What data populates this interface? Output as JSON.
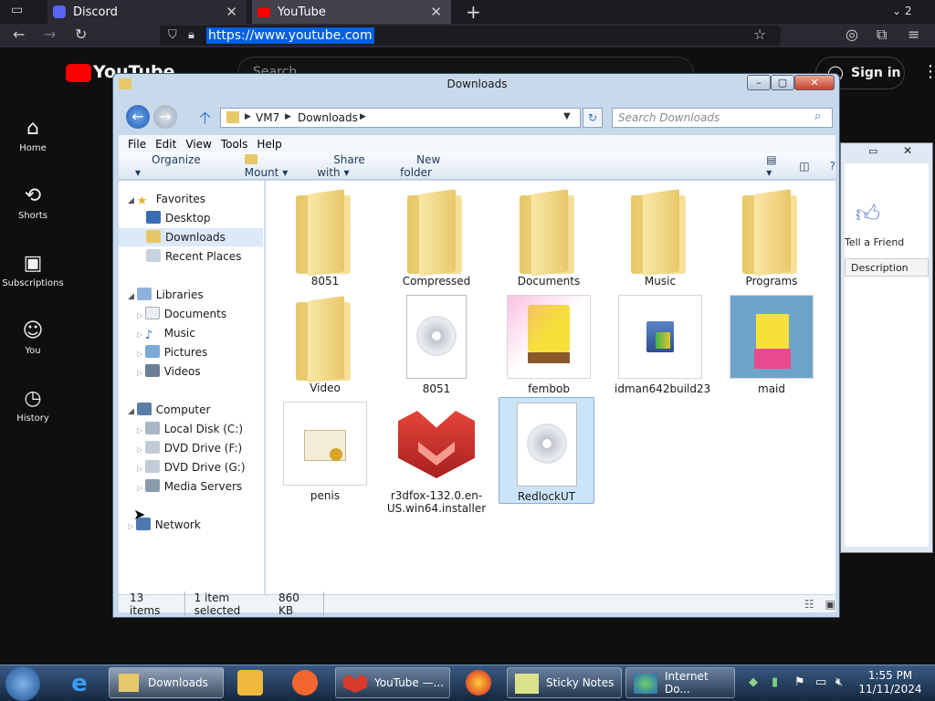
{
  "browser": {
    "tab1_title": "Discord",
    "tab2_title": "YouTube",
    "tab_count": "2",
    "url": "https://www.youtube.com"
  },
  "youtube": {
    "logo": "YouTube",
    "search_placeholder": "Search",
    "sidebar": [
      {
        "label": "Home"
      },
      {
        "label": "Shorts"
      },
      {
        "label": "Subscriptions"
      },
      {
        "label": "You"
      },
      {
        "label": "History"
      }
    ],
    "sign_in": "Sign in"
  },
  "bg_window": {
    "tell_friend": "Tell a Friend",
    "col": "Description"
  },
  "explorer": {
    "title": "Downloads",
    "breadcrumb": [
      "VM7",
      "Downloads"
    ],
    "search_placeholder": "Search Downloads",
    "menu": [
      "File",
      "Edit",
      "View",
      "Tools",
      "Help"
    ],
    "cmd": {
      "organize": "Organize",
      "mount": "Mount",
      "share": "Share with",
      "newfolder": "New folder"
    },
    "nav": {
      "favorites": "Favorites",
      "desktop": "Desktop",
      "downloads": "Downloads",
      "recent": "Recent Places",
      "libraries": "Libraries",
      "documents": "Documents",
      "music": "Music",
      "pictures": "Pictures",
      "videos": "Videos",
      "computer": "Computer",
      "local": "Local Disk (C:)",
      "dvdf": "DVD Drive (F:)",
      "dvdg": "DVD Drive (G:)",
      "media": "Media Servers",
      "network": "Network"
    },
    "files": [
      "8051",
      "Compressed",
      "Documents",
      "Music",
      "Programs",
      "Video",
      "8051",
      "fembob",
      "idman642build23",
      "maid",
      "penis",
      "r3dfox-132.0.en-US.win64.installer",
      "RedlockUT"
    ],
    "status": {
      "items": "13 items",
      "selected": "1 item selected",
      "size": "860 KB"
    }
  },
  "taskbar": {
    "downloads": "Downloads",
    "youtube": "YouTube —...",
    "sticky": "Sticky Notes",
    "idm": "Internet Do...",
    "time": "1:55 PM",
    "date": "11/11/2024"
  }
}
